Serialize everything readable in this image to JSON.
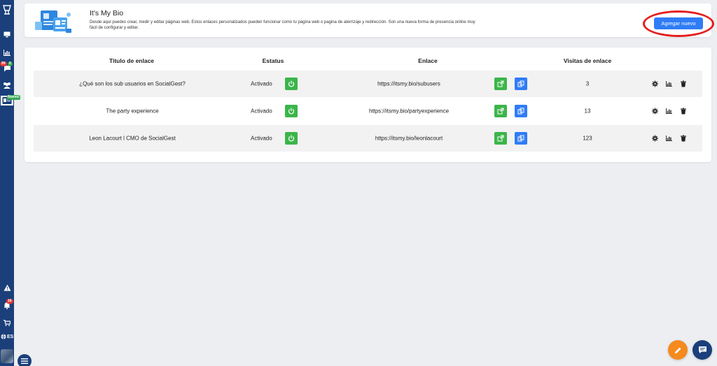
{
  "sidebar": {
    "badges": {
      "chat": "99",
      "chat_secondary": "0",
      "notifications": "16",
      "new_label": "Nuevo!"
    },
    "language": "ES",
    "icons": [
      "app-logo-icon",
      "monitor-icon",
      "bar-chart-icon",
      "chat-icon",
      "users-icon",
      "bio-card-icon",
      "warning-icon",
      "bell-icon",
      "cart-icon",
      "globe-icon",
      "menu-icon"
    ]
  },
  "header": {
    "title": "It's My Bio",
    "description": "Desde aquí puedes crear, medir y editar páginas web. Estos enlaces personalizados pueden funcionar como tu página web o pagina de aterrizaje y redirección. Son una nueva forma de presencia online muy fácil de configurar y editar.",
    "add_button_label": "Agregar nuevo",
    "highlight_color": "#e41e1e"
  },
  "table": {
    "columns": [
      "Titulo de enlace",
      "Estatus",
      "Enlace",
      "Visitas de enlace"
    ],
    "rows": [
      {
        "title": "¿Qué son los sub usuarios en SocialGest?",
        "status": "Activado",
        "link": "https://itsmy.bio/subusers",
        "visits": "3"
      },
      {
        "title": "The party experience",
        "status": "Activado",
        "link": "https://itsmy.bio/partyexperience",
        "visits": "13"
      },
      {
        "title": "Leon Lacourt l CMO de SocialGest",
        "status": "Activado",
        "link": "https://itsmy.bio/leonlacourt",
        "visits": "123"
      }
    ]
  },
  "colors": {
    "sidebar": "#1b3f7a",
    "primary_button": "#2f7cf6",
    "success": "#3bb54a",
    "fab_orange": "#f58a1f"
  }
}
